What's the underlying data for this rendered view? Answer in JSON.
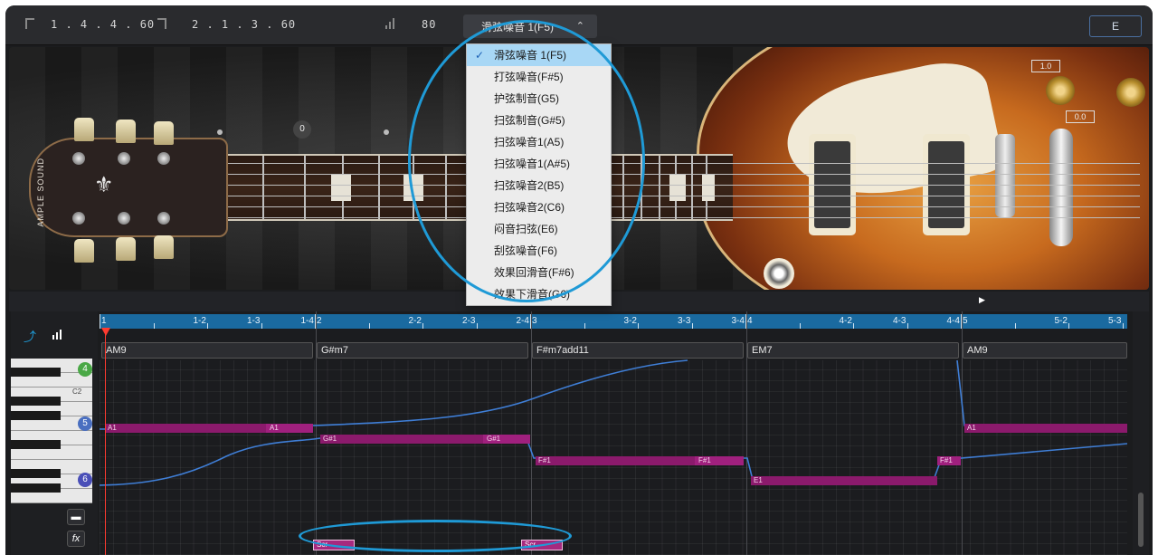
{
  "toolbar": {
    "position_start": "1 . 4 . 4 . 60",
    "position_end": "2 . 1 . 3 . 60",
    "velocity": "80",
    "articulation_selected": "滑弦噪音 1(F5)",
    "right_button": "E"
  },
  "dropdown": {
    "items": [
      "滑弦噪音 1(F5)",
      "打弦噪音(F#5)",
      "护弦制音(G5)",
      "扫弦制音(G#5)",
      "扫弦噪音1(A5)",
      "扫弦噪音1(A#5)",
      "扫弦噪音2(B5)",
      "扫弦噪音2(C6)",
      "闷音扫弦(E6)",
      "刮弦噪音(F6)",
      "效果回滑音(F#6)",
      "效果下滑音(G6)"
    ],
    "selected_index": 0
  },
  "guitar": {
    "logo": "AMPLE SOUND",
    "knob_zero": "0",
    "value_1": "1.0",
    "value_2": "0.0"
  },
  "ruler": {
    "labels": [
      "1",
      "1-2",
      "1-3",
      "1-4",
      "2",
      "2-2",
      "2-3",
      "2-4",
      "3",
      "3-2",
      "3-3",
      "3-4",
      "4",
      "4-2",
      "4-3",
      "4-4",
      "5",
      "5-2",
      "5-3",
      "5-"
    ]
  },
  "chords": [
    "AM9",
    "G#m7",
    "F#m7add11",
    "EM7",
    "AM9"
  ],
  "keyboard": {
    "badge_4": "4",
    "badge_5": "5",
    "badge_6": "6",
    "c2_label": "C2"
  },
  "notes": {
    "a1_start": "A1",
    "a1_end": "A1",
    "gs1_start": "G#1",
    "gs1_end": "G#1",
    "fs1_start": "F#1",
    "fs1_end": "F#1",
    "e1": "E1",
    "fs1_b": "F#1",
    "a1_b": "A1"
  },
  "fx": {
    "scr_1": "Scr",
    "scr_2": "Scr"
  },
  "colors": {
    "accent": "#1f9ad6",
    "note": "#8b1a6c",
    "ruler": "#1a6aa0",
    "highlight_ring": "#1f9ad6"
  }
}
